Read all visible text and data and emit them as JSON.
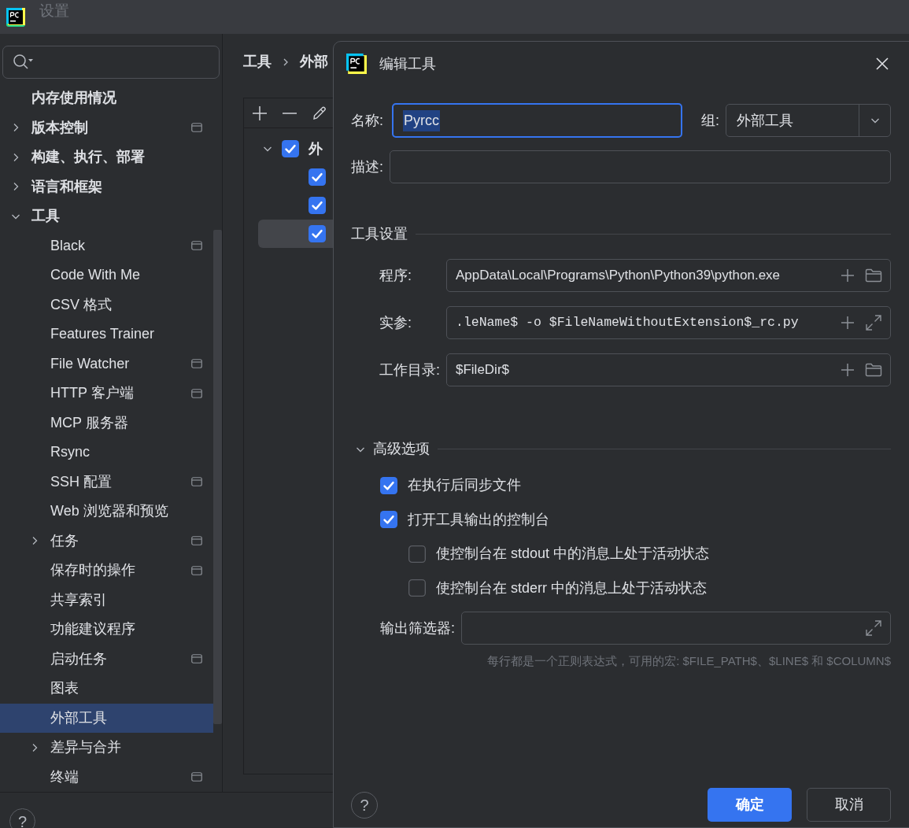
{
  "window": {
    "title": "设置"
  },
  "sidebar": {
    "items": [
      {
        "label": "内存使用情况",
        "kind": "page",
        "project_icon": false,
        "selected": false
      },
      {
        "label": "版本控制",
        "kind": "folder",
        "expanded": false,
        "project_icon": true,
        "selected": false
      },
      {
        "label": "构建、执行、部署",
        "kind": "folder",
        "expanded": false,
        "project_icon": false,
        "selected": false
      },
      {
        "label": "语言和框架",
        "kind": "folder",
        "expanded": false,
        "project_icon": false,
        "selected": false
      },
      {
        "label": "工具",
        "kind": "folder",
        "expanded": true,
        "project_icon": false,
        "selected": false,
        "children": [
          {
            "label": "Black",
            "kind": "page",
            "project_icon": true,
            "selected": false
          },
          {
            "label": "Code With Me",
            "kind": "page",
            "project_icon": false,
            "selected": false
          },
          {
            "label": "CSV 格式",
            "kind": "page",
            "project_icon": false,
            "selected": false
          },
          {
            "label": "Features Trainer",
            "kind": "page",
            "project_icon": false,
            "selected": false
          },
          {
            "label": "File Watcher",
            "kind": "page",
            "project_icon": true,
            "selected": false
          },
          {
            "label": "HTTP 客户端",
            "kind": "page",
            "project_icon": true,
            "selected": false
          },
          {
            "label": "MCP 服务器",
            "kind": "page",
            "project_icon": false,
            "selected": false
          },
          {
            "label": "Rsync",
            "kind": "page",
            "project_icon": false,
            "selected": false
          },
          {
            "label": "SSH 配置",
            "kind": "page",
            "project_icon": true,
            "selected": false
          },
          {
            "label": "Web 浏览器和预览",
            "kind": "page",
            "project_icon": false,
            "selected": false
          },
          {
            "label": "任务",
            "kind": "folder",
            "expanded": false,
            "project_icon": true,
            "selected": false
          },
          {
            "label": "保存时的操作",
            "kind": "page",
            "project_icon": true,
            "selected": false
          },
          {
            "label": "共享索引",
            "kind": "page",
            "project_icon": false,
            "selected": false
          },
          {
            "label": "功能建议程序",
            "kind": "page",
            "project_icon": false,
            "selected": false
          },
          {
            "label": "启动任务",
            "kind": "page",
            "project_icon": true,
            "selected": false
          },
          {
            "label": "图表",
            "kind": "page",
            "project_icon": false,
            "selected": false
          },
          {
            "label": "外部工具",
            "kind": "page",
            "project_icon": false,
            "selected": true
          },
          {
            "label": "差异与合并",
            "kind": "folder",
            "expanded": false,
            "project_icon": false,
            "selected": false
          },
          {
            "label": "终端",
            "kind": "page",
            "project_icon": true,
            "selected": false
          }
        ]
      }
    ]
  },
  "breadcrumb": [
    "工具",
    "外部"
  ],
  "tool_tree": {
    "group": {
      "label": "外",
      "checked": true,
      "expanded": true
    },
    "items": [
      {
        "checked": true,
        "selected": false
      },
      {
        "checked": true,
        "selected": false
      },
      {
        "checked": true,
        "selected": true
      }
    ]
  },
  "dialog": {
    "title": "编辑工具",
    "name": {
      "label": "名称:",
      "value": "Pyrcc",
      "focused": true
    },
    "group": {
      "label": "组:",
      "value": "外部工具"
    },
    "description": {
      "label": "描述:"
    },
    "tool_settings": {
      "title": "工具设置",
      "fields": [
        {
          "label": "程序:",
          "value": "AppData\\Local\\Programs\\Python\\Python39\\python.exe",
          "kind": "browse"
        },
        {
          "label": "实参:",
          "value": ".leName$ -o $FileNameWithoutExtension$_rc.py",
          "kind": "expand"
        },
        {
          "label": "工作目录:",
          "value": "$FileDir$",
          "kind": "browse"
        }
      ]
    },
    "advanced": {
      "title": "高级选项",
      "expanded": true,
      "options": [
        {
          "label": "在执行后同步文件",
          "checked": true
        },
        {
          "label": "打开工具输出的控制台",
          "checked": true,
          "children": [
            {
              "label": "使控制台在 stdout 中的消息上处于活动状态",
              "checked": false
            },
            {
              "label": "使控制台在 stderr 中的消息上处于活动状态",
              "checked": false
            }
          ]
        }
      ],
      "output_filter": {
        "label": "输出筛选器:",
        "hint": "每行都是一个正则表达式，可用的宏: $FILE_PATH$、$LINE$ 和 $COLUMN$"
      }
    },
    "buttons": [
      {
        "label": "确定",
        "primary": true
      },
      {
        "label": "取消",
        "primary": false
      }
    ]
  },
  "help_buttons": [
    "?",
    "?"
  ]
}
